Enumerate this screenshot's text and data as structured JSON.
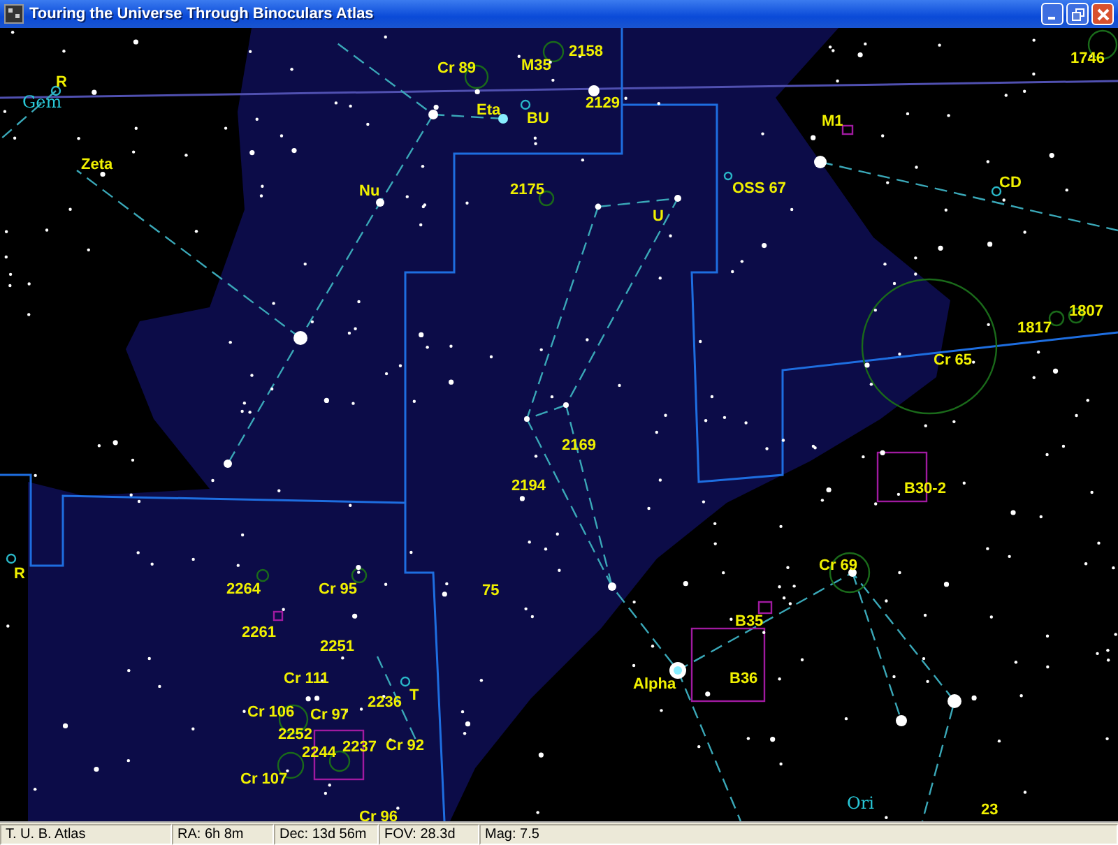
{
  "window": {
    "title": "Touring the Universe Through Binoculars Atlas"
  },
  "map": {
    "labels": [
      {
        "text": "Gem",
        "kind": "constellation"
      },
      {
        "text": "R",
        "kind": "object"
      },
      {
        "text": "Zeta",
        "kind": "object"
      },
      {
        "text": "Cr 89",
        "kind": "object"
      },
      {
        "text": "M35",
        "kind": "object"
      },
      {
        "text": "2158",
        "kind": "object"
      },
      {
        "text": "Eta",
        "kind": "object"
      },
      {
        "text": "BU",
        "kind": "object"
      },
      {
        "text": "2129",
        "kind": "object"
      },
      {
        "text": "1746",
        "kind": "object"
      },
      {
        "text": "M1",
        "kind": "object"
      },
      {
        "text": "Nu",
        "kind": "object"
      },
      {
        "text": "2175",
        "kind": "object"
      },
      {
        "text": "U",
        "kind": "object"
      },
      {
        "text": "OSS 67",
        "kind": "object"
      },
      {
        "text": "CD",
        "kind": "object"
      },
      {
        "text": "1807",
        "kind": "object"
      },
      {
        "text": "1817",
        "kind": "object"
      },
      {
        "text": "Cr 65",
        "kind": "object"
      },
      {
        "text": "2169",
        "kind": "object"
      },
      {
        "text": "2194",
        "kind": "object"
      },
      {
        "text": "B30-2",
        "kind": "object"
      },
      {
        "text": "R",
        "kind": "object"
      },
      {
        "text": "2264",
        "kind": "object"
      },
      {
        "text": "Cr 95",
        "kind": "object"
      },
      {
        "text": "75",
        "kind": "object"
      },
      {
        "text": "Cr 69",
        "kind": "object"
      },
      {
        "text": "B35",
        "kind": "object"
      },
      {
        "text": "2261",
        "kind": "object"
      },
      {
        "text": "2251",
        "kind": "object"
      },
      {
        "text": "Cr 111",
        "kind": "object"
      },
      {
        "text": "T",
        "kind": "object"
      },
      {
        "text": "Alpha",
        "kind": "object"
      },
      {
        "text": "B36",
        "kind": "object"
      },
      {
        "text": "2236",
        "kind": "object"
      },
      {
        "text": "Cr 106",
        "kind": "object"
      },
      {
        "text": "Cr 97",
        "kind": "object"
      },
      {
        "text": "2252",
        "kind": "object"
      },
      {
        "text": "2237",
        "kind": "object"
      },
      {
        "text": "Cr 92",
        "kind": "object"
      },
      {
        "text": "2244",
        "kind": "object"
      },
      {
        "text": "Cr 107",
        "kind": "object"
      },
      {
        "text": "Cr 96",
        "kind": "object"
      },
      {
        "text": "Ori",
        "kind": "constellation"
      },
      {
        "text": "23",
        "kind": "object"
      }
    ]
  },
  "status_bar": [
    "T. U. B. Atlas",
    "RA: 6h 8m",
    "Dec: 13d 56m",
    "FOV: 28.3d",
    "Mag: 7.5"
  ]
}
